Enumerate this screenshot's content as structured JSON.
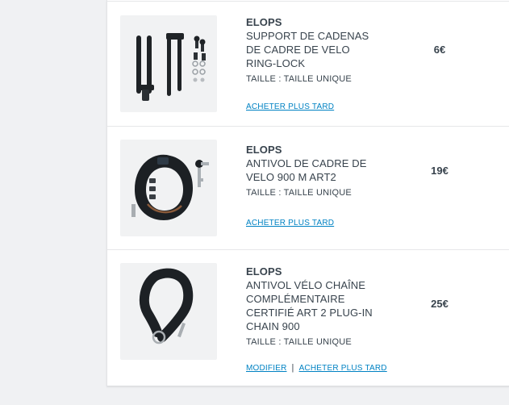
{
  "cart": {
    "items": [
      {
        "brand": "ELOPS",
        "name_lines": [
          "SUPPORT DE CADENAS",
          "DE CADRE DE VELO",
          "RING-LOCK"
        ],
        "size": "TAILLE : TAILLE UNIQUE",
        "price": "6€",
        "save_later": "ACHETER PLUS TARD",
        "image_icon": "lock-mount-bracket-icon"
      },
      {
        "brand": "ELOPS",
        "name_lines": [
          "ANTIVOL DE CADRE DE",
          "VELO 900 M ART2"
        ],
        "size": "TAILLE : TAILLE UNIQUE",
        "price": "19€",
        "save_later": "ACHETER PLUS TARD",
        "image_icon": "frame-ring-lock-icon"
      },
      {
        "brand": "ELOPS",
        "name_lines": [
          "ANTIVOL VÉLO CHAÎNE",
          "COMPLÉMENTAIRE",
          "CERTIFIÉ ART 2 PLUG-IN",
          "CHAIN 900"
        ],
        "size": "TAILLE : TAILLE UNIQUE",
        "price": "25€",
        "modify": "MODIFIER",
        "save_later": "ACHETER PLUS TARD",
        "image_icon": "chain-lock-icon"
      }
    ]
  },
  "colors": {
    "text": "#38434d",
    "link": "#0082c3",
    "background": "#f0f1f3",
    "card": "#ffffff"
  }
}
